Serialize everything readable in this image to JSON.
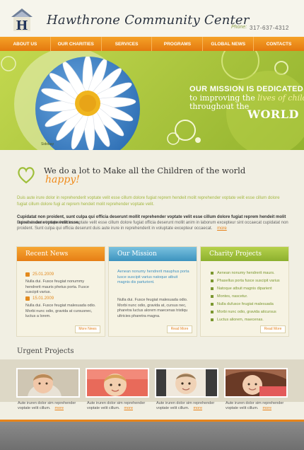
{
  "header": {
    "title": "Hawthrone Community Center",
    "phone_label": "Phone:",
    "phone_number": "317-637-4312"
  },
  "nav": {
    "items": [
      "ABOUT US",
      "OUR CHARITIES",
      "SERVICES",
      "PROGRAMS",
      "GLOBAL NEWS",
      "CONTACTS"
    ]
  },
  "banner": {
    "credit": "Sidebay",
    "mission_line1": "OUR MISSION IS DEDICATED",
    "mission_line2_a": "to improving the ",
    "mission_line2_b": "lives of children",
    "mission_line3": "throughout the",
    "mission_world": "WORLD"
  },
  "intro": {
    "heading": "We do a lot to Make all the Children of the world",
    "heading_happy": "happy!",
    "para1": "Duis aute irure dolor in reprehenderit voptate velit esse cillum dolore fugiat reprem hendeit molit reprehender voptate velit esse cillum dolore fugiat cillum dolore fugi at reprem hendeit molit reprehender voptate velit.",
    "para2": "Cupidatat non proident, sunt culpa qui officia deserunt mollit reprehender voptate velit esse cillum dolore fugiat reprem hendeit molit reprehender voptate velit esse.",
    "para3": "Duis aute aute in reprehender voptate velit esse cillum dolore fugiat officia deserunt mollit anim in laborum excepteur sint occaecat cupidatat non proident. Sunt culpa qui officia deserunt duis aute irure in reprehenderit in voluptate excepteur occaecat.",
    "more": "more"
  },
  "recent_news": {
    "title": "Recent News",
    "items": [
      {
        "date": "25.01.2009",
        "text": "Nulla dui. Fusce feugiat nonummy hendrerit mauris phetus porta. Fusce suscipit varius."
      },
      {
        "date": "15.01.2009",
        "text": "Nulla dui. Fusce feugiat malesuada odio. Morbi nunc odio, gravida at cursusnec, luctus a lorem."
      }
    ],
    "more": "More News"
  },
  "our_mission": {
    "title": "Our Mission",
    "text1": "Aenean nonumy hendrerit mauphus porta lusce suscipit varius natoque atbuit magnis dis parturient.",
    "text2": "Nulla dui. Fusce feugiat malesuada odio. Morbi nunc odio, gravida at, cursus nec, pharetra luctus alorem maecenas tristiqu ultricies pharetra magna.",
    "more": "Read More"
  },
  "charity_projects": {
    "title": "Charity Projects",
    "items": [
      "Aenean nonumy hendrerit maurs.",
      "Phasellus porta fusce suscipit varius",
      "Natoque atbuit magnis diparient",
      "Montes, nascetur.",
      "Nulla dufusce feugiat malesuada",
      "Morbi nunc odio, gravida aticursus",
      "Luctus aliorem, maecenas."
    ],
    "more": "Read More"
  },
  "urgent": {
    "title": "Urgent Projects",
    "items": [
      {
        "caption": "Aute iruren dolor sim reprehender voptate velit cillum.",
        "more": "more"
      },
      {
        "caption": "Aute iruren dolor sim reprehender voptate velit cillum.",
        "more": "more"
      },
      {
        "caption": "Aute iruren dolor sim reprehender voptate velit cillum.",
        "more": "more"
      },
      {
        "caption": "Aute iruren dolor sim reprehender voptate velit cillum.",
        "more": "more"
      }
    ]
  },
  "colors": {
    "accent_orange": "#e8841a",
    "accent_green": "#93b32e",
    "accent_blue": "#3c93bf"
  }
}
